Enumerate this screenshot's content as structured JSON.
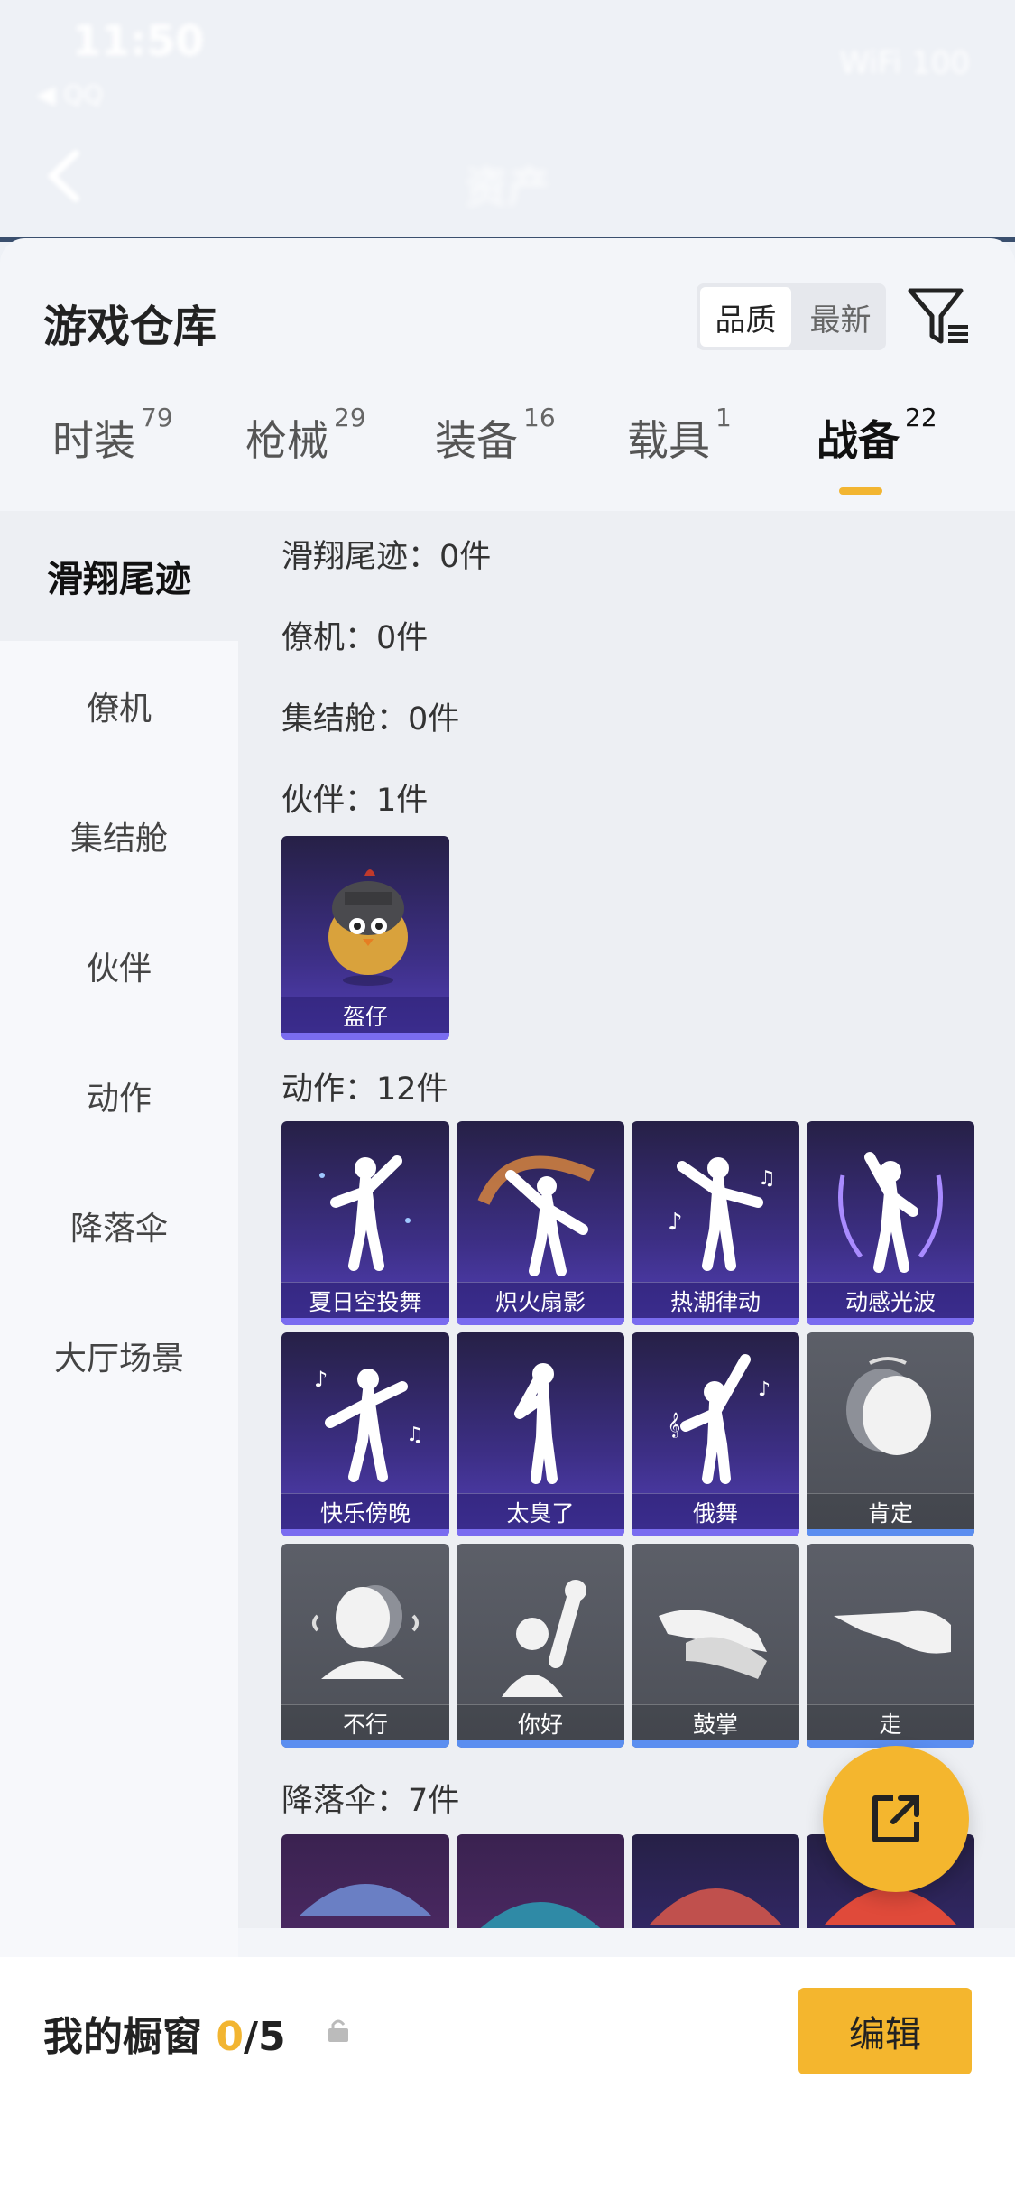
{
  "status": {
    "time": "11:50",
    "sub": "◀ QQ",
    "right": "WiFi 100"
  },
  "header": {
    "title": "资产"
  },
  "sheet": {
    "title": "游戏仓库"
  },
  "sort": {
    "options": [
      "品质",
      "最新"
    ],
    "active": "品质"
  },
  "tabs": [
    {
      "label": "时装",
      "count": "79"
    },
    {
      "label": "枪械",
      "count": "29"
    },
    {
      "label": "装备",
      "count": "16"
    },
    {
      "label": "载具",
      "count": "1"
    },
    {
      "label": "战备",
      "count": "22",
      "active": true
    }
  ],
  "rail": [
    {
      "label": "滑翔尾迹",
      "active": true
    },
    {
      "label": "僚机"
    },
    {
      "label": "集结舱"
    },
    {
      "label": "伙伴"
    },
    {
      "label": "动作"
    },
    {
      "label": "降落伞"
    },
    {
      "label": "大厅场景"
    }
  ],
  "sections": {
    "glide": "滑翔尾迹：0件",
    "wingman": "僚机：0件",
    "pod": "集结舱：0件",
    "partner": "伙伴：1件",
    "emote": "动作：12件",
    "parachute": "降落伞：7件"
  },
  "partner_items": [
    {
      "name": "盔仔"
    }
  ],
  "emote_items": [
    {
      "name": "夏日空投舞",
      "style": "purple",
      "icon": "dancer-sparkle-icon"
    },
    {
      "name": "炽火扇影",
      "style": "purple",
      "icon": "dancer-fire-icon"
    },
    {
      "name": "热潮律动",
      "style": "purple",
      "icon": "dancer-notes-icon"
    },
    {
      "name": "动感光波",
      "style": "purple",
      "icon": "dancer-wave-icon"
    },
    {
      "name": "快乐傍晚",
      "style": "purple",
      "icon": "dancer-notes-icon"
    },
    {
      "name": "太臭了",
      "style": "purple",
      "icon": "dancer-pose-icon"
    },
    {
      "name": "俄舞",
      "style": "purple",
      "icon": "dancer-notes-icon"
    },
    {
      "name": "肯定",
      "style": "gray",
      "icon": "head-nod-icon"
    },
    {
      "name": "不行",
      "style": "gray",
      "icon": "head-shake-icon"
    },
    {
      "name": "你好",
      "style": "gray",
      "icon": "wave-hand-icon"
    },
    {
      "name": "鼓掌",
      "style": "gray",
      "icon": "clap-icon"
    },
    {
      "name": "走",
      "style": "gray",
      "icon": "point-icon"
    }
  ],
  "bottom": {
    "label": "我的橱窗",
    "count": "0",
    "total": "/5",
    "edit": "编辑"
  },
  "colors": {
    "accent": "#f4b62e",
    "purple_card": "#3d2f86",
    "gray_card": "#54575f"
  }
}
